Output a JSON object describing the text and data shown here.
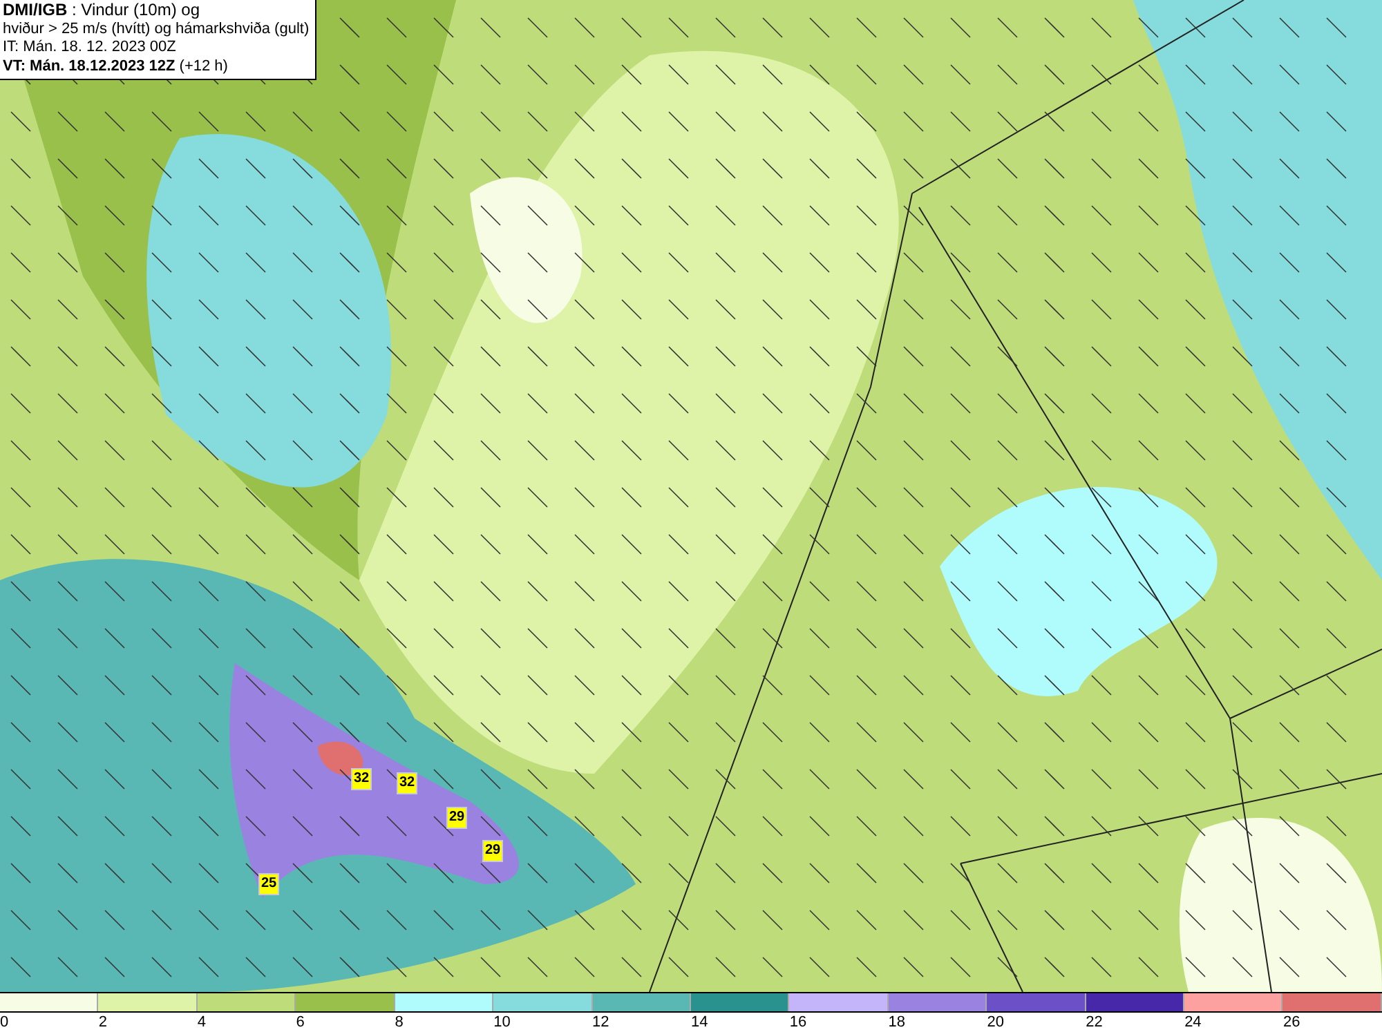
{
  "legend": {
    "lines": [
      "**DMI/IGB** : Vindur (10m) og",
      "hviður > 25 m/s (hvítt) og hámarkshviða (gult)",
      "IT: Mán. 18. 12. 2023 00Z",
      "**VT: Mán. 18.12.2023 12Z** (+12 h)"
    ]
  },
  "gust_labels": [
    "32",
    "32",
    "29",
    "29",
    "25"
  ],
  "colorbar": {
    "segments": [
      {
        "color": "#f7fde4"
      },
      {
        "color": "#def3a8"
      },
      {
        "color": "#bedd7a"
      },
      {
        "color": "#98c04a"
      },
      {
        "color": "#b0fcfc"
      },
      {
        "color": "#86dcdc"
      },
      {
        "color": "#5ab8b4"
      },
      {
        "color": "#2a928e"
      },
      {
        "color": "#c4b4fa"
      },
      {
        "color": "#9a82e0"
      },
      {
        "color": "#6c50c8"
      },
      {
        "color": "#4628a8"
      },
      {
        "color": "#fca0a0"
      },
      {
        "color": "#e07070"
      }
    ],
    "ticks": [
      "0",
      "2",
      "4",
      "6",
      "8",
      "10",
      "12",
      "14",
      "16",
      "18",
      "20",
      "22",
      "24",
      "26"
    ]
  }
}
